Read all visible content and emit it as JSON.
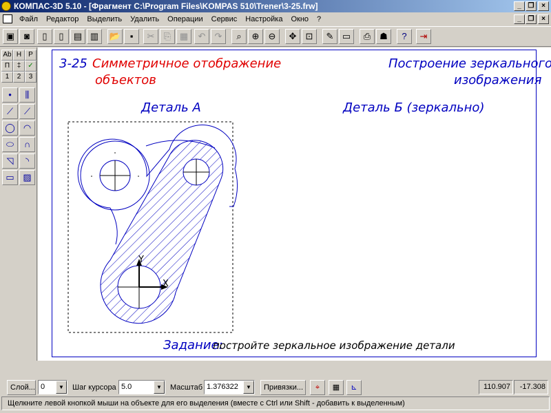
{
  "window": {
    "title": "КОМПАС-3D 5.10 - [Фрагмент C:\\Program Files\\KOMPAS 510\\Trener\\3-25.frw]"
  },
  "menubar": {
    "items": [
      {
        "label": "Файл"
      },
      {
        "label": "Редактор"
      },
      {
        "label": "Выделить"
      },
      {
        "label": "Удалить"
      },
      {
        "label": "Операции"
      },
      {
        "label": "Сервис"
      },
      {
        "label": "Настройка"
      },
      {
        "label": "Окно"
      },
      {
        "label": "?"
      }
    ]
  },
  "left_panel": {
    "small_buttons": [
      "Ab",
      "H",
      "P",
      "П",
      "‡",
      "✓",
      "1",
      "2",
      "3"
    ]
  },
  "drawing": {
    "lesson_number": "3-25",
    "lesson_title_line1": "Симметричное отображение",
    "lesson_title_line2": "объектов",
    "right_title_line1": "Построение зеркального",
    "right_title_line2": "изображения",
    "detail_a_label": "Деталь А",
    "detail_b_label": "Деталь Б (зеркально)",
    "task_label": "Задание:",
    "task_text": "постройте зеркальное изображение детали",
    "axis_x": "X",
    "axis_y": "Y",
    "colors": {
      "title_red": "#e00000",
      "drawing_blue": "#0000c0"
    }
  },
  "statusbar": {
    "layer_button": "Слой...",
    "layer_value": "0",
    "step_label": "Шаг курсора",
    "step_value": "5.0",
    "scale_label": "Масштаб",
    "scale_value": "1.376322",
    "snap_button": "Привязки...",
    "coord_x": "110.907",
    "coord_y": "-17.308",
    "hint": "Щелкните левой кнопкой мыши на объекте для его выделения (вместе с Ctrl или Shift - добавить к выделенным)"
  }
}
